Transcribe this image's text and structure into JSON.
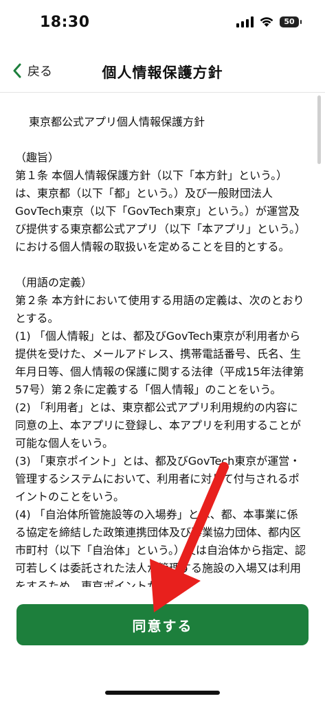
{
  "status_bar": {
    "time": "18:30",
    "battery": "50"
  },
  "nav": {
    "back_label": "戻る",
    "title": "個人情報保護方針"
  },
  "document": {
    "title": "東京都公式アプリ個人情報保護方針",
    "section1_heading": "（趣旨）",
    "section1_body": "第１条 本個人情報保護方針（以下「本方針」という。）は、東京都（以下「都」という。）及び一般財団法人GovTech東京（以下「GovTech東京」という。）が運営及び提供する東京都公式アプリ（以下「本アプリ」という。）における個人情報の取扱いを定めることを目的とする。",
    "section2_heading": "（用語の定義）",
    "section2_intro": "第２条 本方針において使用する用語の定義は、次のとおりとする。",
    "items": [
      "(1) 「個人情報」とは、都及びGovTech東京が利用者から提供を受けた、メールアドレス、携帯電話番号、氏名、生年月日等、個人情報の保護に関する法律（平成15年法律第57号）第２条に定義する「個人情報」のことをいう。",
      "(2) 「利用者」とは、東京都公式アプリ利用規約の内容に同意の上、本アプリに登録し、本アプリを利用することが可能な個人をいう。",
      "(3) 「東京ポイント」とは、都及びGovTech東京が運営・管理するシステムにおいて、利用者に対して付与されるポイントのことをいう。",
      "(4) 「自治体所管施設等の入場券」とは、都、本事業に係る協定を締結した政策連携団体及び事業協力団体、都内区市町村（以下「自治体」という。）又は自治体から指定、認可若しくは委託された法人が管理する施設の入場又は利用をするため、東京ポイントから交"
    ]
  },
  "agree_button": {
    "label": "同意する"
  },
  "colors": {
    "accent": "#1d7f3c",
    "arrow": "#e8201d"
  },
  "icons": {
    "back": "chevron-left-icon",
    "signal": "signal-icon",
    "wifi": "wifi-icon",
    "battery": "battery-icon"
  }
}
